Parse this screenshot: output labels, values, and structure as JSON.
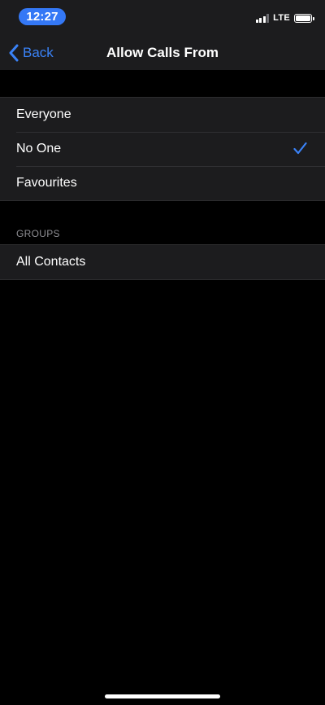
{
  "status_bar": {
    "time": "12:27",
    "network": "LTE",
    "accent_color": "#3478f6"
  },
  "nav": {
    "back_label": "Back",
    "title": "Allow Calls From"
  },
  "options": [
    {
      "label": "Everyone",
      "selected": false
    },
    {
      "label": "No One",
      "selected": true
    },
    {
      "label": "Favourites",
      "selected": false
    }
  ],
  "groups_section": {
    "header": "GROUPS",
    "items": [
      {
        "label": "All Contacts"
      }
    ]
  },
  "icons": {
    "back": "chevron-left-icon",
    "selected": "checkmark-icon",
    "signal": "signal-bars-icon",
    "battery": "battery-icon"
  }
}
